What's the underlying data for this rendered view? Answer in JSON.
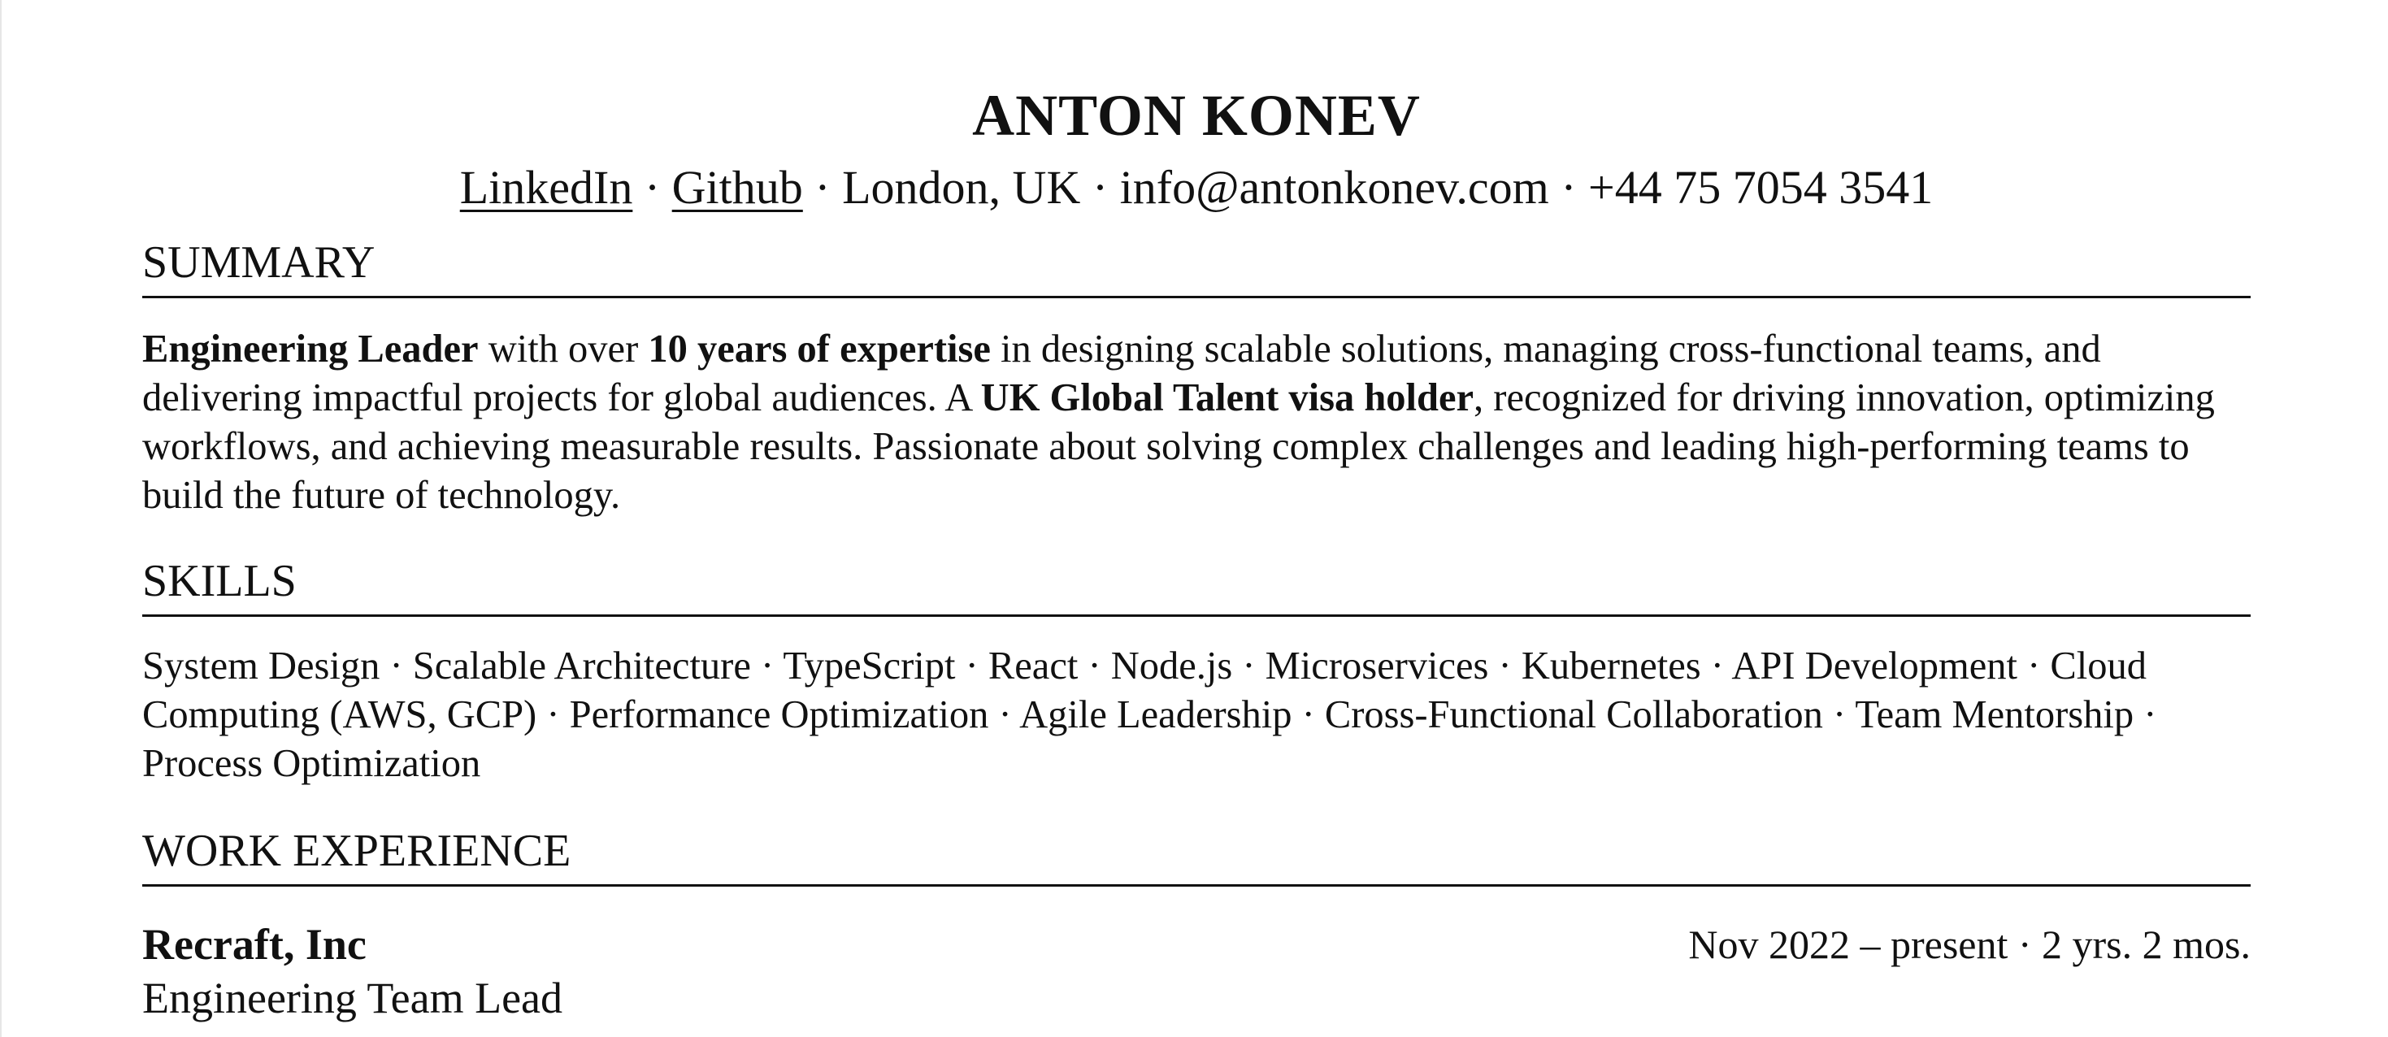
{
  "header": {
    "name": "ANTON KONEV",
    "links": {
      "linkedin": "LinkedIn",
      "github": "Github"
    },
    "separator": " · ",
    "location": "London, UK",
    "email": "info@antonkonev.com",
    "phone": "+44 75 7054 3541"
  },
  "summary": {
    "title": "SUMMARY",
    "segments": [
      {
        "text": "Engineering Leader",
        "bold": true
      },
      {
        "text": " with over ",
        "bold": false
      },
      {
        "text": "10 years of expertise",
        "bold": true
      },
      {
        "text": " in designing scalable solutions, managing cross-functional teams, and delivering impactful projects for global audiences. A ",
        "bold": false
      },
      {
        "text": "UK Global Talent visa holder",
        "bold": true
      },
      {
        "text": ", recognized for driving innovation, optimizing workflows, and achieving measurable results. Passionate about solving complex challenges and leading high-performing teams to build the future of technology.",
        "bold": false
      }
    ]
  },
  "skills": {
    "title": "SKILLS",
    "items": [
      "System Design",
      "Scalable Architecture",
      "TypeScript",
      "React",
      "Node.js",
      "Microservices",
      "Kubernetes",
      "API Development",
      "Cloud Computing (AWS, GCP)",
      "Performance Optimization",
      "Agile Leadership",
      "Cross-Functional Collaboration",
      "Team Mentorship",
      "Process Optimization"
    ]
  },
  "experience": {
    "title": "WORK EXPERIENCE",
    "jobs": [
      {
        "company": "Recraft, Inc",
        "dates": "Nov 2022 – present · 2 yrs. 2 mos.",
        "role": "Engineering Team Lead"
      }
    ]
  }
}
